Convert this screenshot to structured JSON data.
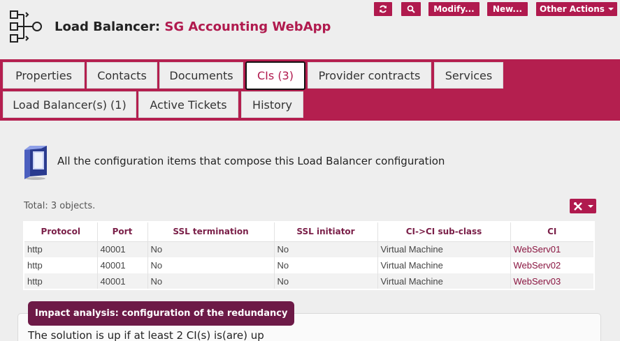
{
  "header": {
    "title_prefix": "Load Balancer:",
    "object_name": "SG Accounting WebApp"
  },
  "actions": {
    "refresh_icon": "refresh-icon",
    "search_icon": "search-icon",
    "modify_label": "Modify...",
    "new_label": "New...",
    "other_actions_label": "Other Actions"
  },
  "tabs": [
    {
      "label": "Properties",
      "active": false
    },
    {
      "label": "Contacts",
      "active": false
    },
    {
      "label": "Documents",
      "active": false
    },
    {
      "label": "CIs (3)",
      "active": true
    },
    {
      "label": "Provider contracts",
      "active": false
    },
    {
      "label": "Services",
      "active": false
    },
    {
      "label": "Load Balancer(s) (1)",
      "active": false
    },
    {
      "label": "Active Tickets",
      "active": false
    },
    {
      "label": "History",
      "active": false
    }
  ],
  "content": {
    "description": "All the configuration items that compose this Load Balancer configuration",
    "total": "Total: 3 objects.",
    "tool_icon": "tools-icon"
  },
  "table": {
    "columns": [
      "Protocol",
      "Port",
      "SSL termination",
      "SSL initiator",
      "CI->CI sub-class",
      "CI"
    ],
    "rows": [
      [
        "http",
        "40001",
        "No",
        "No",
        "Virtual Machine",
        "WebServ01"
      ],
      [
        "http",
        "40001",
        "No",
        "No",
        "Virtual Machine",
        "WebServ02"
      ],
      [
        "http",
        "40001",
        "No",
        "No",
        "Virtual Machine",
        "WebServ03"
      ]
    ]
  },
  "impact": {
    "title": "Impact analysis: configuration of the redundancy",
    "text": "The solution is up if at least 2 CI(s) is(are) up"
  },
  "colors": {
    "brand": "#b01a4e",
    "band": "#b41f4f",
    "badge": "#6d1a47"
  }
}
